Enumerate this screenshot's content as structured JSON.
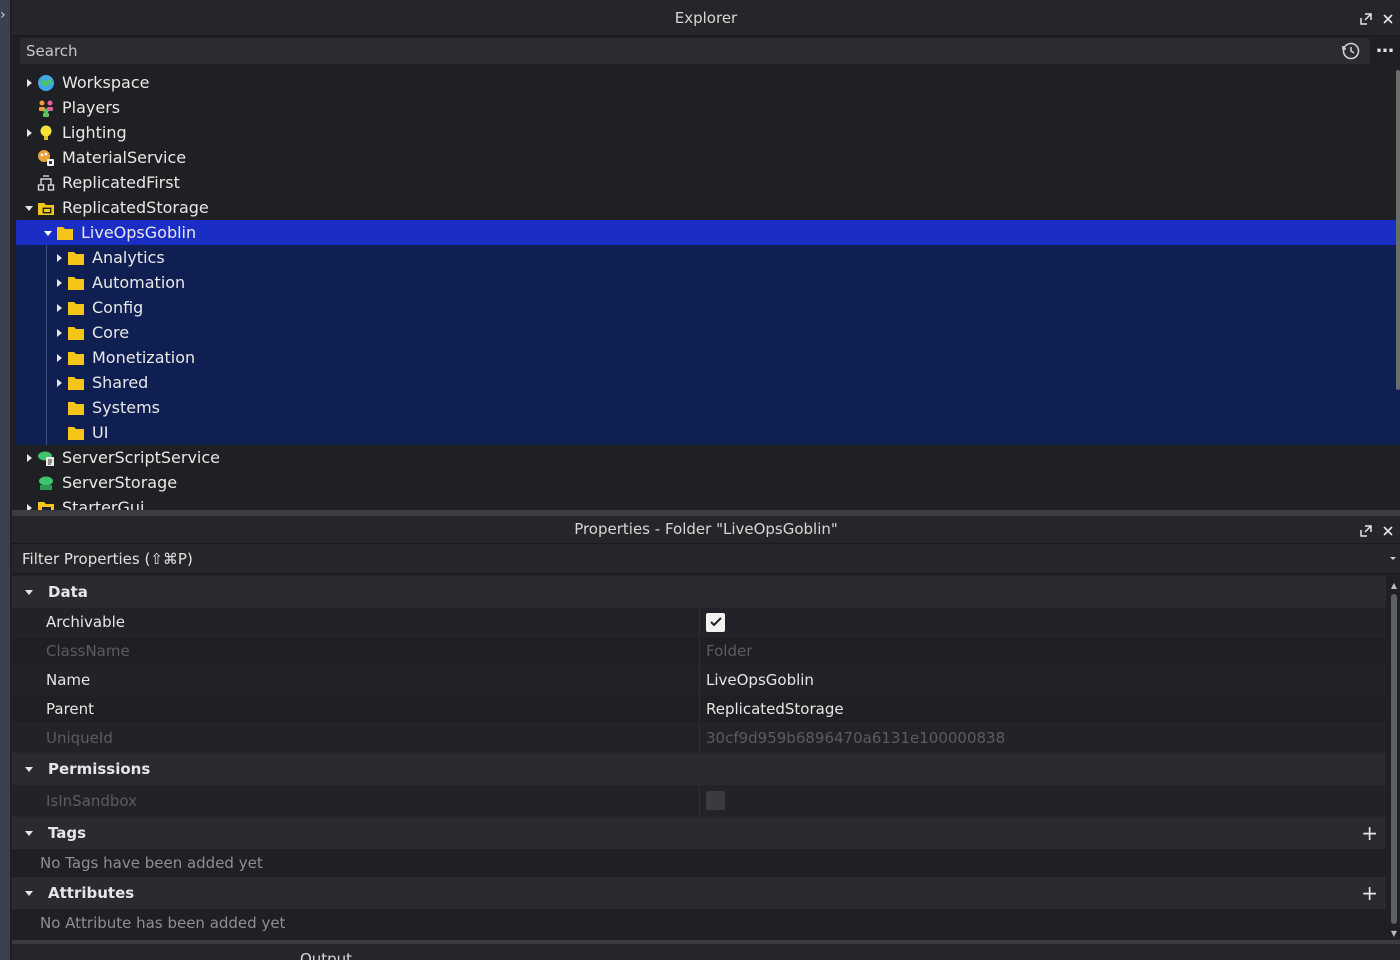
{
  "explorer": {
    "title": "Explorer",
    "search_placeholder": "Search",
    "items": [
      {
        "label": "Workspace"
      },
      {
        "label": "Players"
      },
      {
        "label": "Lighting"
      },
      {
        "label": "MaterialService"
      },
      {
        "label": "ReplicatedFirst"
      },
      {
        "label": "ReplicatedStorage"
      },
      {
        "label": "LiveOpsGoblin"
      },
      {
        "label": "Analytics"
      },
      {
        "label": "Automation"
      },
      {
        "label": "Config"
      },
      {
        "label": "Core"
      },
      {
        "label": "Monetization"
      },
      {
        "label": "Shared"
      },
      {
        "label": "Systems"
      },
      {
        "label": "UI"
      },
      {
        "label": "ServerScriptService"
      },
      {
        "label": "ServerStorage"
      },
      {
        "label": "StarterGui"
      }
    ]
  },
  "properties": {
    "title": "Properties - Folder \"LiveOpsGoblin\"",
    "filter_placeholder": "Filter Properties (⇧⌘P)",
    "sections": {
      "data": "Data",
      "permissions": "Permissions",
      "tags": "Tags",
      "attributes": "Attributes"
    },
    "rows": {
      "archivable": {
        "name": "Archivable",
        "checked": true
      },
      "classname": {
        "name": "ClassName",
        "value": "Folder"
      },
      "name": {
        "name": "Name",
        "value": "LiveOpsGoblin"
      },
      "parent": {
        "name": "Parent",
        "value": "ReplicatedStorage"
      },
      "uniqueid": {
        "name": "UniqueId",
        "value": "30cf9d959b6896470a6131e100000838"
      },
      "isinsandbox": {
        "name": "IsInSandbox",
        "checked": false
      }
    },
    "tags_empty": "No Tags have been added yet",
    "attributes_empty": "No Attribute has been added yet"
  },
  "output": {
    "title": "Output"
  },
  "colors": {
    "selection": "#1a2ec6",
    "selection_children": "#0f1f52",
    "folder": "#f5c518"
  }
}
